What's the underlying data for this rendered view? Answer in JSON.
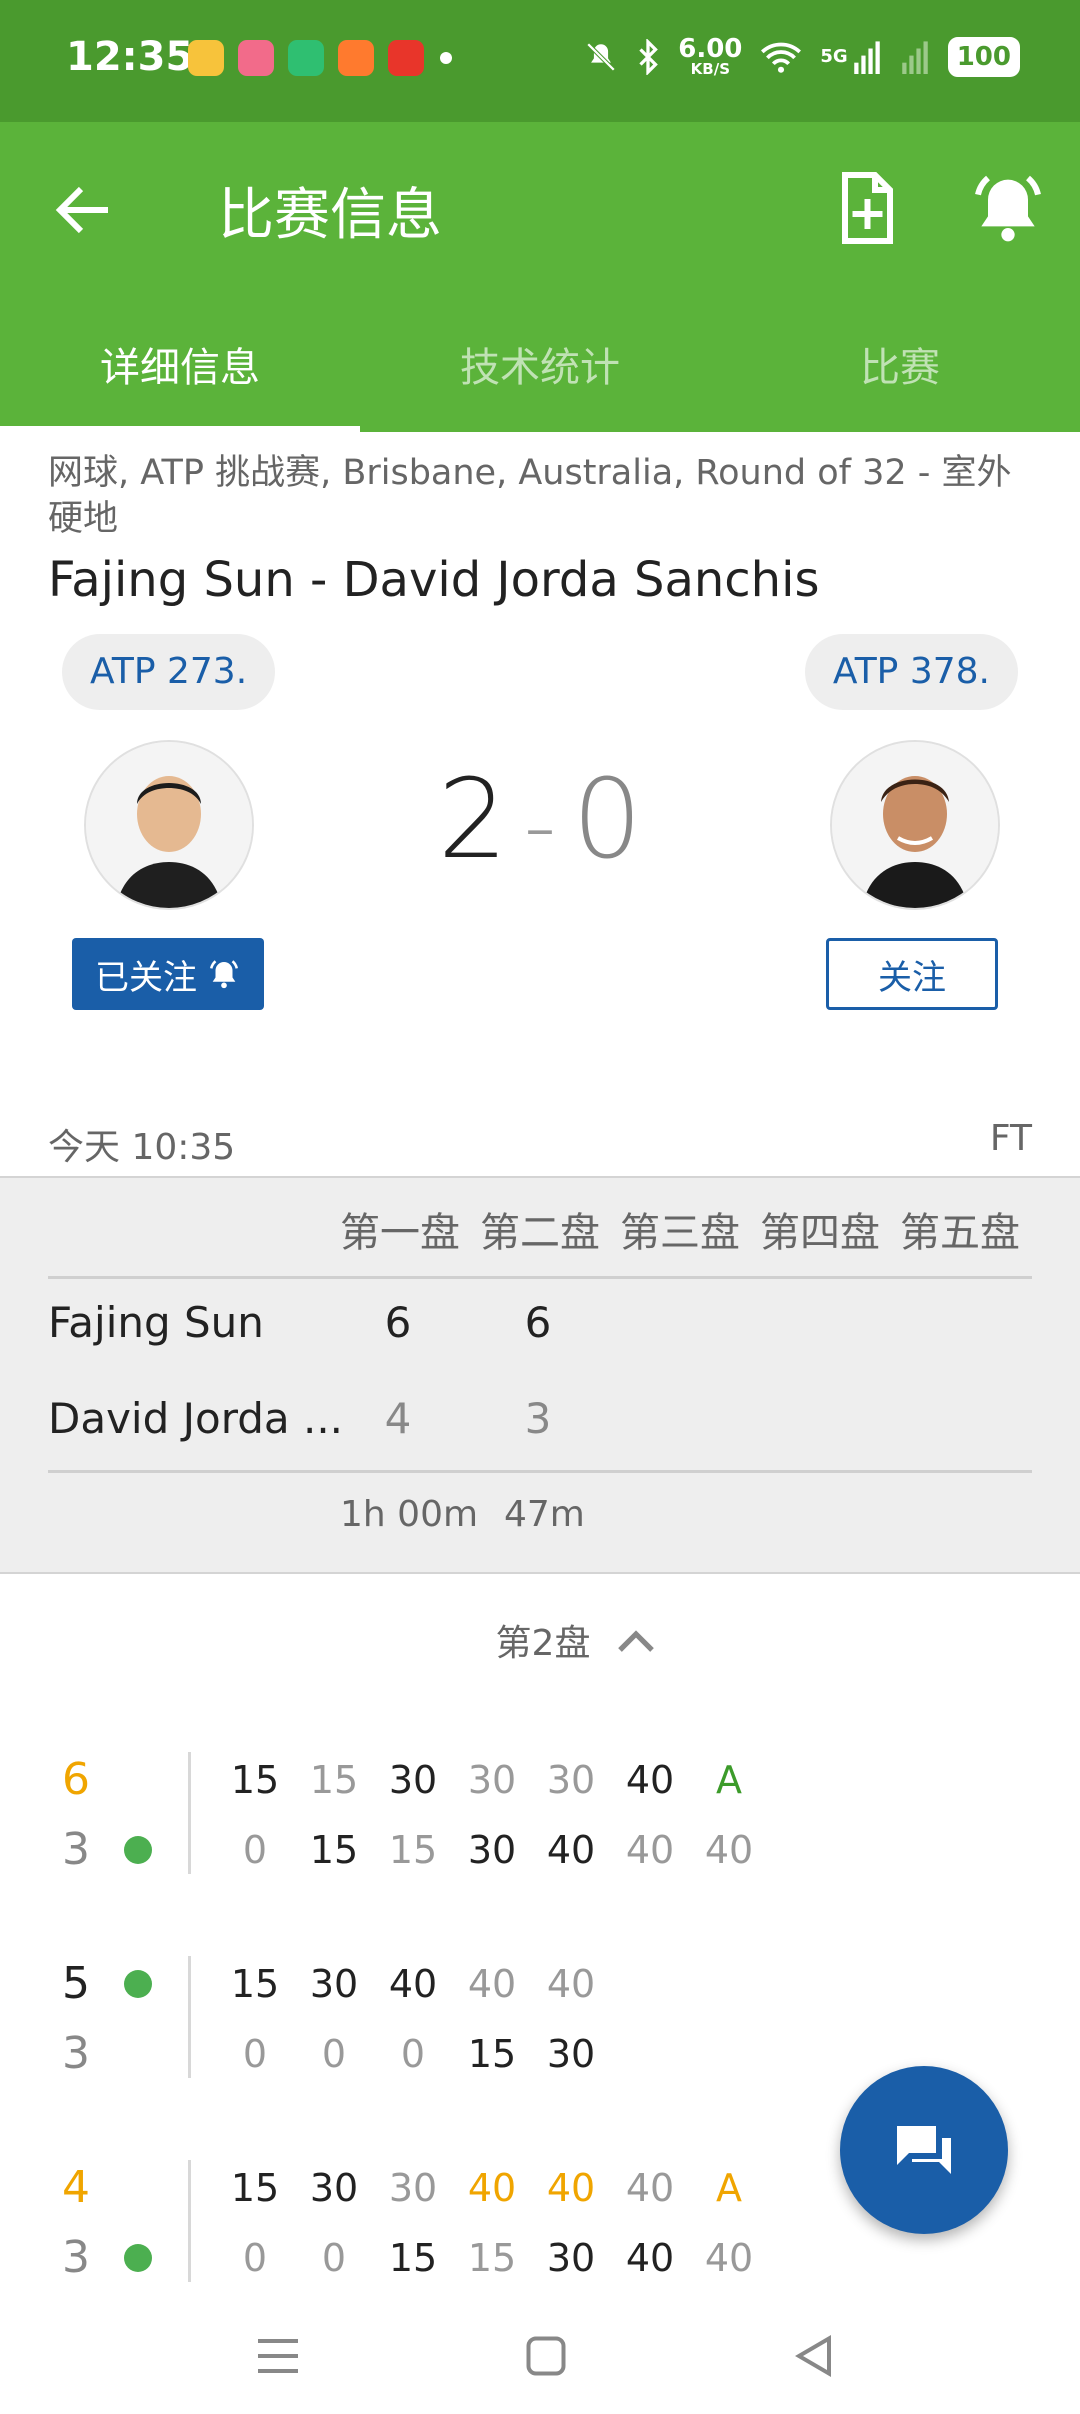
{
  "status_bar": {
    "time": "12:35",
    "speed_value": "6.00",
    "speed_unit": "KB/S",
    "network": "5G",
    "battery": "100"
  },
  "app_bar": {
    "title": "比赛信息"
  },
  "tabs": [
    {
      "label": "详细信息",
      "active": true
    },
    {
      "label": "技术统计",
      "active": false
    },
    {
      "label": "比赛",
      "active": false
    }
  ],
  "match": {
    "breadcrumb": "网球, ATP 挑战赛, Brisbane, Australia, Round of 32 - 室外硬地",
    "title": "Fajing Sun - David Jorda Sanchis",
    "home": {
      "rank": "ATP 273.",
      "follow_label": "已关注"
    },
    "away": {
      "rank": "ATP 378.",
      "follow_label": "关注"
    },
    "score_home": "2",
    "score_sep": "-",
    "score_away": "0",
    "time": "今天 10:35",
    "status": "FT"
  },
  "sets_table": {
    "headers": [
      "第一盘",
      "第二盘",
      "第三盘",
      "第四盘",
      "第五盘"
    ],
    "rows": [
      {
        "name": "Fajing Sun",
        "sets": [
          "6",
          "6"
        ]
      },
      {
        "name": "David Jorda ...",
        "sets": [
          "4",
          "3"
        ]
      }
    ],
    "durations": [
      "1h 00m",
      "47m"
    ]
  },
  "set_toggle": {
    "label": "第2盘"
  },
  "games": [
    {
      "top_score": "6",
      "bottom_score": "3",
      "top_points": [
        "15",
        "15",
        "30",
        "30",
        "30",
        "40",
        "A"
      ],
      "bottom_points": [
        "0",
        "15",
        "15",
        "30",
        "40",
        "40",
        "40"
      ]
    },
    {
      "top_score": "5",
      "bottom_score": "3",
      "top_points": [
        "15",
        "30",
        "40",
        "40",
        "40"
      ],
      "bottom_points": [
        "0",
        "0",
        "0",
        "15",
        "30"
      ]
    },
    {
      "top_score": "4",
      "bottom_score": "3",
      "top_points": [
        "15",
        "30",
        "30",
        "40",
        "40",
        "40",
        "A"
      ],
      "bottom_points": [
        "0",
        "0",
        "15",
        "15",
        "30",
        "40",
        "40"
      ]
    }
  ],
  "colors": {
    "status_bar": "#4a9a2e",
    "app_bar": "#5bb33a",
    "accent_blue": "#1a5ea8",
    "serve_dot": "#4caf50",
    "break_point": "#f0a500",
    "advantage": "#3c9b2a"
  },
  "icons": {
    "back": "arrow-left-icon",
    "add_calendar": "add-file-icon",
    "notifications": "bell-icon",
    "fab": "chat-icon"
  }
}
